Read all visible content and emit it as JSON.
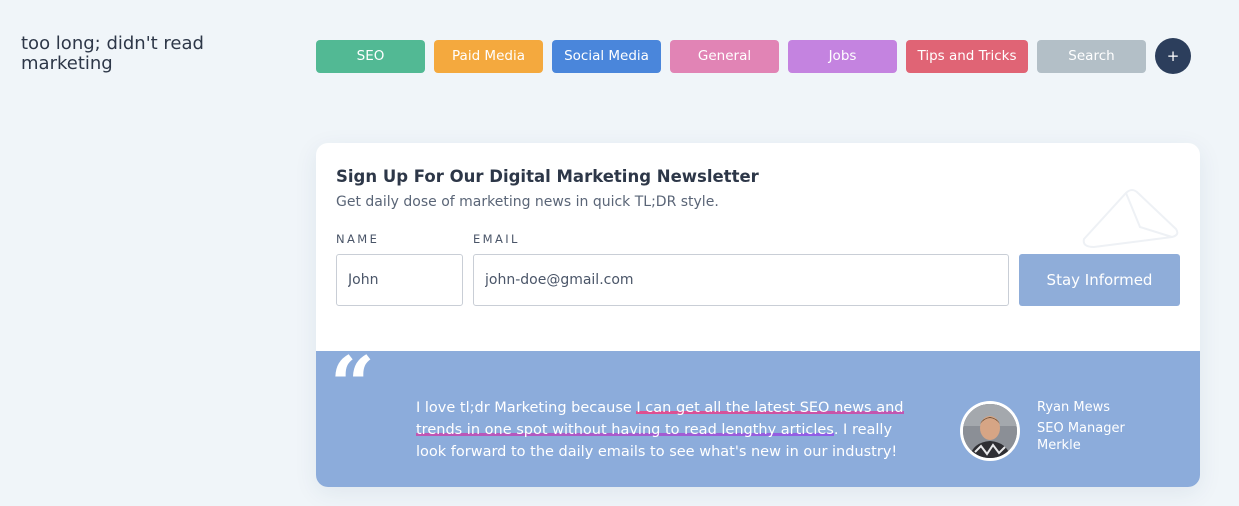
{
  "brand": {
    "line1": "too long; didn't read",
    "line2": "marketing"
  },
  "nav": {
    "items": [
      {
        "label": "SEO",
        "color": "#52b994"
      },
      {
        "label": "Paid Media",
        "color": "#f4a93e"
      },
      {
        "label": "Social Media",
        "color": "#4a86db"
      },
      {
        "label": "General",
        "color": "#e184b5"
      },
      {
        "label": "Jobs",
        "color": "#c483e0"
      },
      {
        "label": "Tips and Tricks",
        "color": "#e06475"
      },
      {
        "label": "Search",
        "color": "#b3bfc7"
      }
    ],
    "plus_label": "+"
  },
  "newsletter": {
    "title": "Sign Up For Our Digital Marketing Newsletter",
    "subtitle": "Get daily dose of marketing news in quick TL;DR style.",
    "name_label": "NAME",
    "name_value": "John",
    "email_label": "EMAIL",
    "email_value": "john-doe@gmail.com",
    "submit_label": "Stay Informed"
  },
  "testimonial": {
    "quote_mark": "“",
    "text_before": "I love tl;dr Marketing because ",
    "text_highlight": "I can get all the latest SEO news and trends in one spot without having to read lengthy articles",
    "text_after": ". I really look forward to the daily emails to see what's new in our industry!",
    "person_name": "Ryan Mews",
    "person_title": "SEO Manager",
    "person_company": "Merkle"
  }
}
